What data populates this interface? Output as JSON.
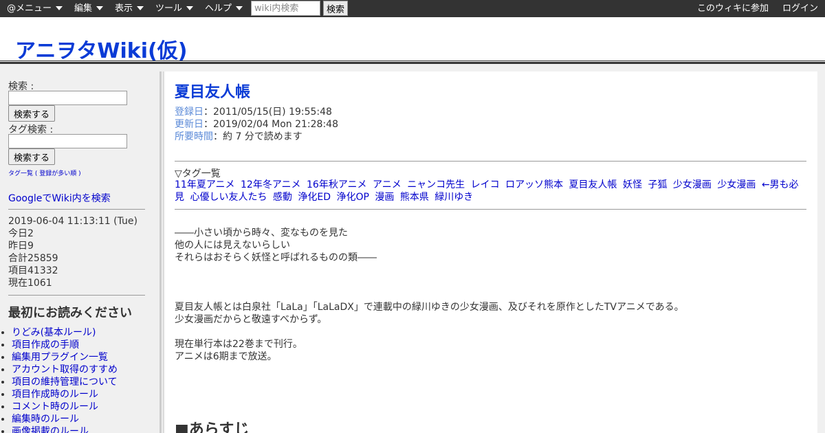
{
  "menubar": {
    "items": [
      "@メニュー",
      "編集",
      "表示",
      "ツール",
      "ヘルプ"
    ],
    "search_placeholder": "wiki内検索",
    "search_button": "検索",
    "join": "このウィキに参加",
    "login": "ログイン"
  },
  "site": {
    "title": "アニヲタWiki(仮)"
  },
  "sidebar": {
    "search_label": "検索 :",
    "search_button": "検索する",
    "tag_search_label": "タグ検索 :",
    "tag_search_button": "検索する",
    "tag_list_link": "タグ一覧",
    "tag_sort_link": "( 登録が多い順 )",
    "google_search": "GoogleでWiki内を検索",
    "datetime": "2019-06-04 11:13:11 (Tue)",
    "today": "今日2",
    "yesterday": "昨日9",
    "total": "合計25859",
    "items": "項目41332",
    "current": "現在1061",
    "read_first_heading": "最初にお読みください",
    "read_first_links": [
      "りどみ(基本ルール)",
      "項目作成の手順",
      "編集用プラグイン一覧",
      "アカウント取得のすすめ",
      "項目の維持管理について",
      "項目作成時のルール",
      "コメント時のルール",
      "編集時のルール",
      "画像掲載のルール"
    ]
  },
  "article": {
    "title": "夏目友人帳",
    "registered_label": "登録日",
    "registered_value": "：2011/05/15(日) 19:55:48",
    "updated_label": "更新日",
    "updated_value": "：2019/02/04 Mon 21:28:48",
    "reading_label": "所要時間",
    "reading_value": "：約 7 分で読めます",
    "tag_heading": "▽タグ一覧",
    "tags": [
      "11年夏アニメ",
      "12年冬アニメ",
      "16年秋アニメ",
      "アニメ",
      "ニャンコ先生",
      "レイコ",
      "ロアッソ熊本",
      "夏目友人帳",
      "妖怪",
      "子狐",
      "少女漫画",
      "少女漫画",
      "←男も必見",
      "心優しい友人たち",
      "感動",
      "浄化ED",
      "浄化OP",
      "漫画",
      "熊本県",
      "緑川ゆき"
    ],
    "quote_lines": [
      "――小さい頃から時々、変なものを見た",
      "他の人には見えないらしい",
      "それらはおそらく妖怪と呼ばれるものの類――"
    ],
    "intro_line1": "夏目友人帳とは白泉社「LaLa」「LaLaDX」で連載中の緑川ゆきの少女漫画、及びそれを原作としたTVアニメである。",
    "intro_line2": "少女漫画だからと敬遠すべからず。",
    "volumes_line": "現在単行本は22巻まで刊行。",
    "anime_line": "アニメは6期まで放送。",
    "section_synopsis": "■あらすじ"
  }
}
